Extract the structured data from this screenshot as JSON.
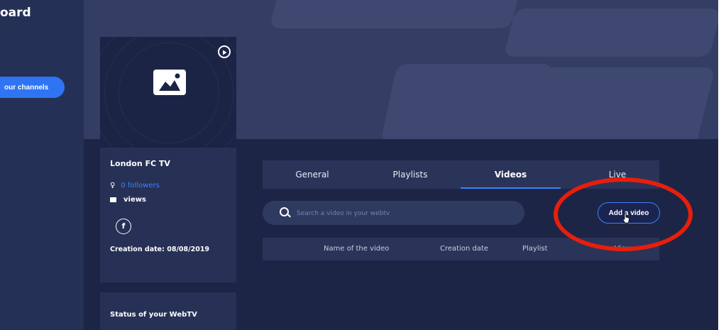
{
  "sidebar": {
    "title": "oard",
    "channels_button": "our channels"
  },
  "channel": {
    "name": "London FC TV",
    "followers": "0 followers",
    "views": "views",
    "creation_label": "Creation date: ",
    "creation_date": "08/08/2019",
    "status_title": "Status of your WebTV",
    "social_icon": "facebook-icon",
    "thumbnail_icon": "image-placeholder-icon",
    "play_icon": "play-icon"
  },
  "tabs": [
    "General",
    "Playlists",
    "Videos",
    "Live"
  ],
  "active_tab": "Videos",
  "search": {
    "placeholder": "Search a video in your webtv"
  },
  "toolbar": {
    "add_video_label": "Add a video"
  },
  "table": {
    "columns": [
      "Name of the video",
      "Creation date",
      "Playlist",
      "Views"
    ]
  },
  "colors": {
    "accent": "#3b82f6",
    "annotation": "#e81e0c",
    "background": "#202a4d"
  }
}
